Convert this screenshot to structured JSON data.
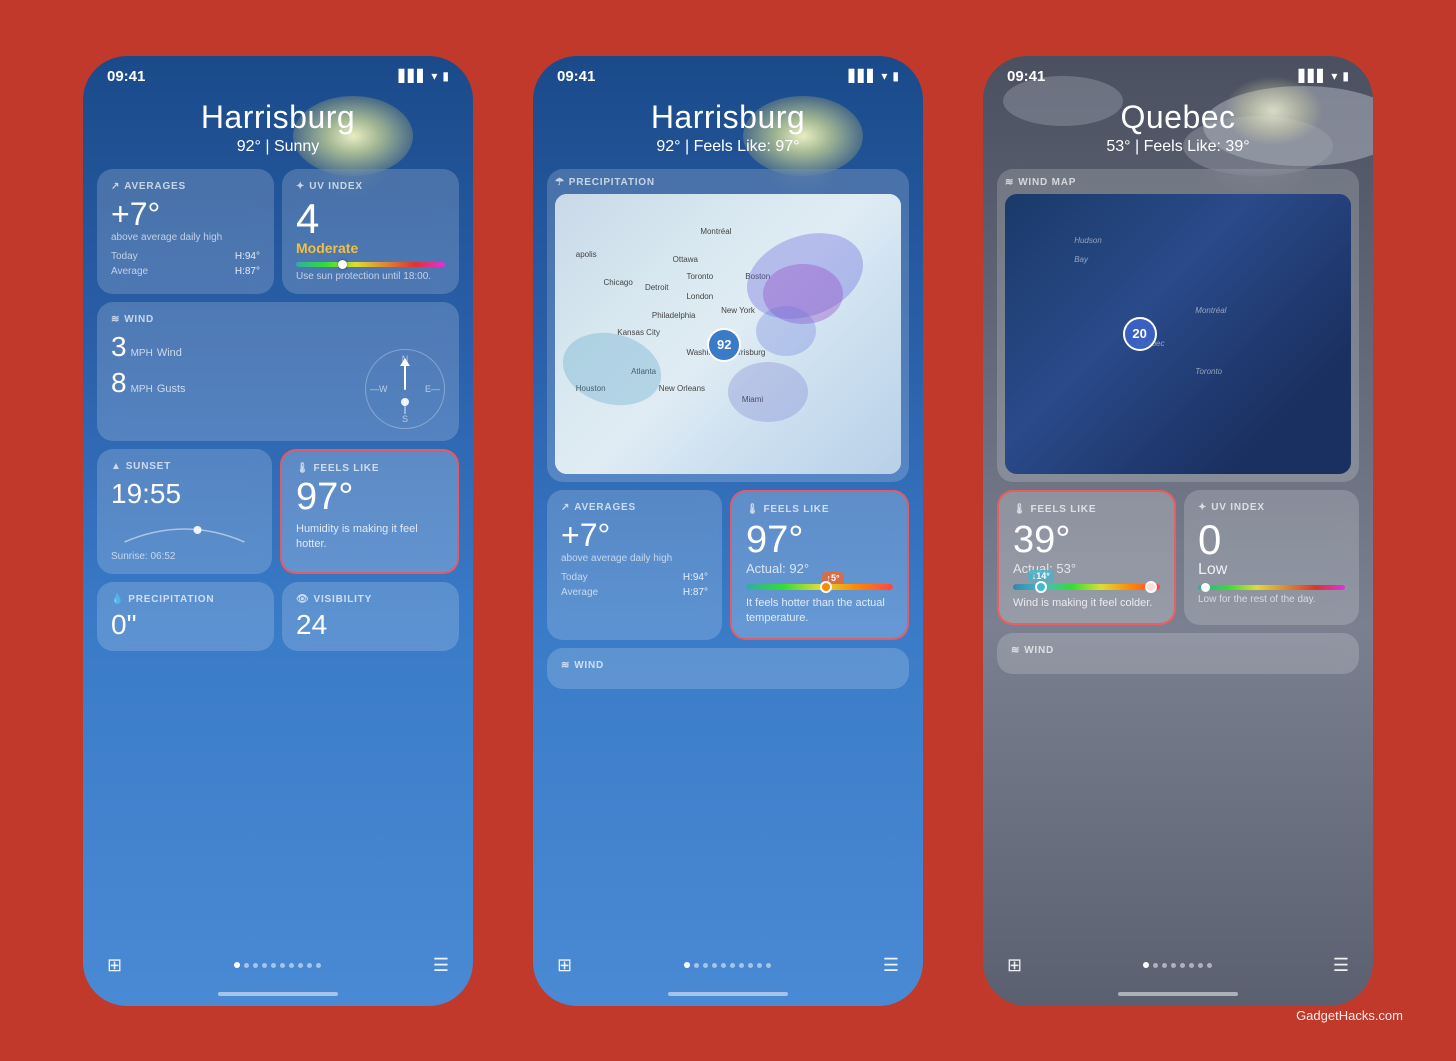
{
  "meta": {
    "watermark": "GadgetHacks.com"
  },
  "phone1": {
    "status": {
      "time": "09:41"
    },
    "city": "Harrisburg",
    "temp": "92°",
    "condition": "Sunny",
    "averages": {
      "label": "AVERAGES",
      "value": "+7°",
      "desc": "above average daily high",
      "today_label": "Today",
      "today_val": "H:94°",
      "avg_label": "Average",
      "avg_val": "H:87°"
    },
    "uv": {
      "label": "UV INDEX",
      "value": "4",
      "level": "Moderate",
      "advice": "Use sun protection until 18:00."
    },
    "wind": {
      "label": "WIND",
      "speed": "3",
      "speed_unit": "MPH",
      "speed_label": "Wind",
      "gust": "8",
      "gust_unit": "MPH",
      "gust_label": "Gusts",
      "direction": "S"
    },
    "sunset": {
      "label": "SUNSET",
      "time": "19:55",
      "sunrise": "Sunrise: 06:52"
    },
    "feels_like": {
      "label": "FEELS LIKE",
      "value": "97°",
      "desc": "Humidity is making it feel hotter."
    },
    "precipitation": {
      "label": "PRECIPITATION"
    },
    "visibility": {
      "label": "VISIBILITY"
    }
  },
  "phone2": {
    "status": {
      "time": "09:41"
    },
    "city": "Harrisburg",
    "temp": "92°",
    "feels_like_header": "Feels Like: 97°",
    "precipitation": {
      "label": "PRECIPITATION",
      "map_temp": "92"
    },
    "averages": {
      "label": "AVERAGES",
      "value": "+7°",
      "desc": "above average daily high",
      "today_label": "Today",
      "today_val": "H:94°",
      "avg_label": "Average",
      "avg_val": "H:87°"
    },
    "feels_like": {
      "label": "FEELS LIKE",
      "value": "97°",
      "actual": "Actual: 92°",
      "diff": "↑5°",
      "desc": "It feels hotter than the actual temperature."
    },
    "wind": {
      "label": "WIND"
    }
  },
  "phone3": {
    "status": {
      "time": "09:41"
    },
    "city": "Quebec",
    "temp": "53°",
    "feels_like_header": "Feels Like: 39°",
    "wind_map": {
      "label": "WIND MAP",
      "speed": "20",
      "city": "Quebec",
      "city2": "Montréal",
      "city3": "Toronto",
      "region": "Hudson Bay"
    },
    "feels_like": {
      "label": "FEELS LIKE",
      "value": "39°",
      "actual": "Actual: 53°",
      "diff": "↓14°",
      "desc": "Wind is making it feel colder."
    },
    "uv": {
      "label": "UV INDEX",
      "value": "0",
      "level": "Low",
      "advice": "Low for the rest of the day."
    },
    "wind": {
      "label": "WIND"
    }
  },
  "dots": {
    "count": 10,
    "active": 0
  }
}
